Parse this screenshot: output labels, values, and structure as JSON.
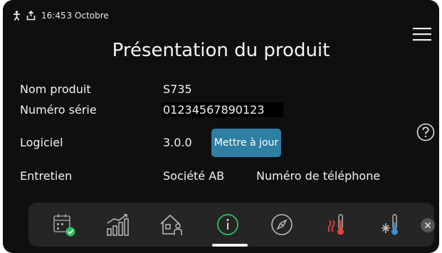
{
  "status_bar": {
    "time": "16:45",
    "date": "3 Octobre",
    "icons": [
      "person-icon",
      "export-icon"
    ]
  },
  "page_title": "Présentation du produit",
  "product": {
    "name_label": "Nom produit",
    "name_value": "S735",
    "serial_label": "Numéro série",
    "serial_value": "01234567890123",
    "software_label": "Logiciel",
    "software_value": "3.0.0",
    "update_button": "Mettre à jour",
    "service_label": "Entretien",
    "service_company": "Société AB",
    "service_phone": "Numéro de téléphone"
  },
  "dock": {
    "items": [
      "calendar-icon",
      "chart-icon",
      "home-user-icon",
      "info-icon",
      "compass-icon",
      "heating-icon",
      "cooling-icon"
    ],
    "active_item": "info-icon"
  },
  "colors": {
    "background": "#0f0f0f",
    "dock": "#252525",
    "accent": "#2f7ea3",
    "active_green": "#2fbf60",
    "heat": "#e0443a",
    "cool": "#3a8fd0"
  }
}
